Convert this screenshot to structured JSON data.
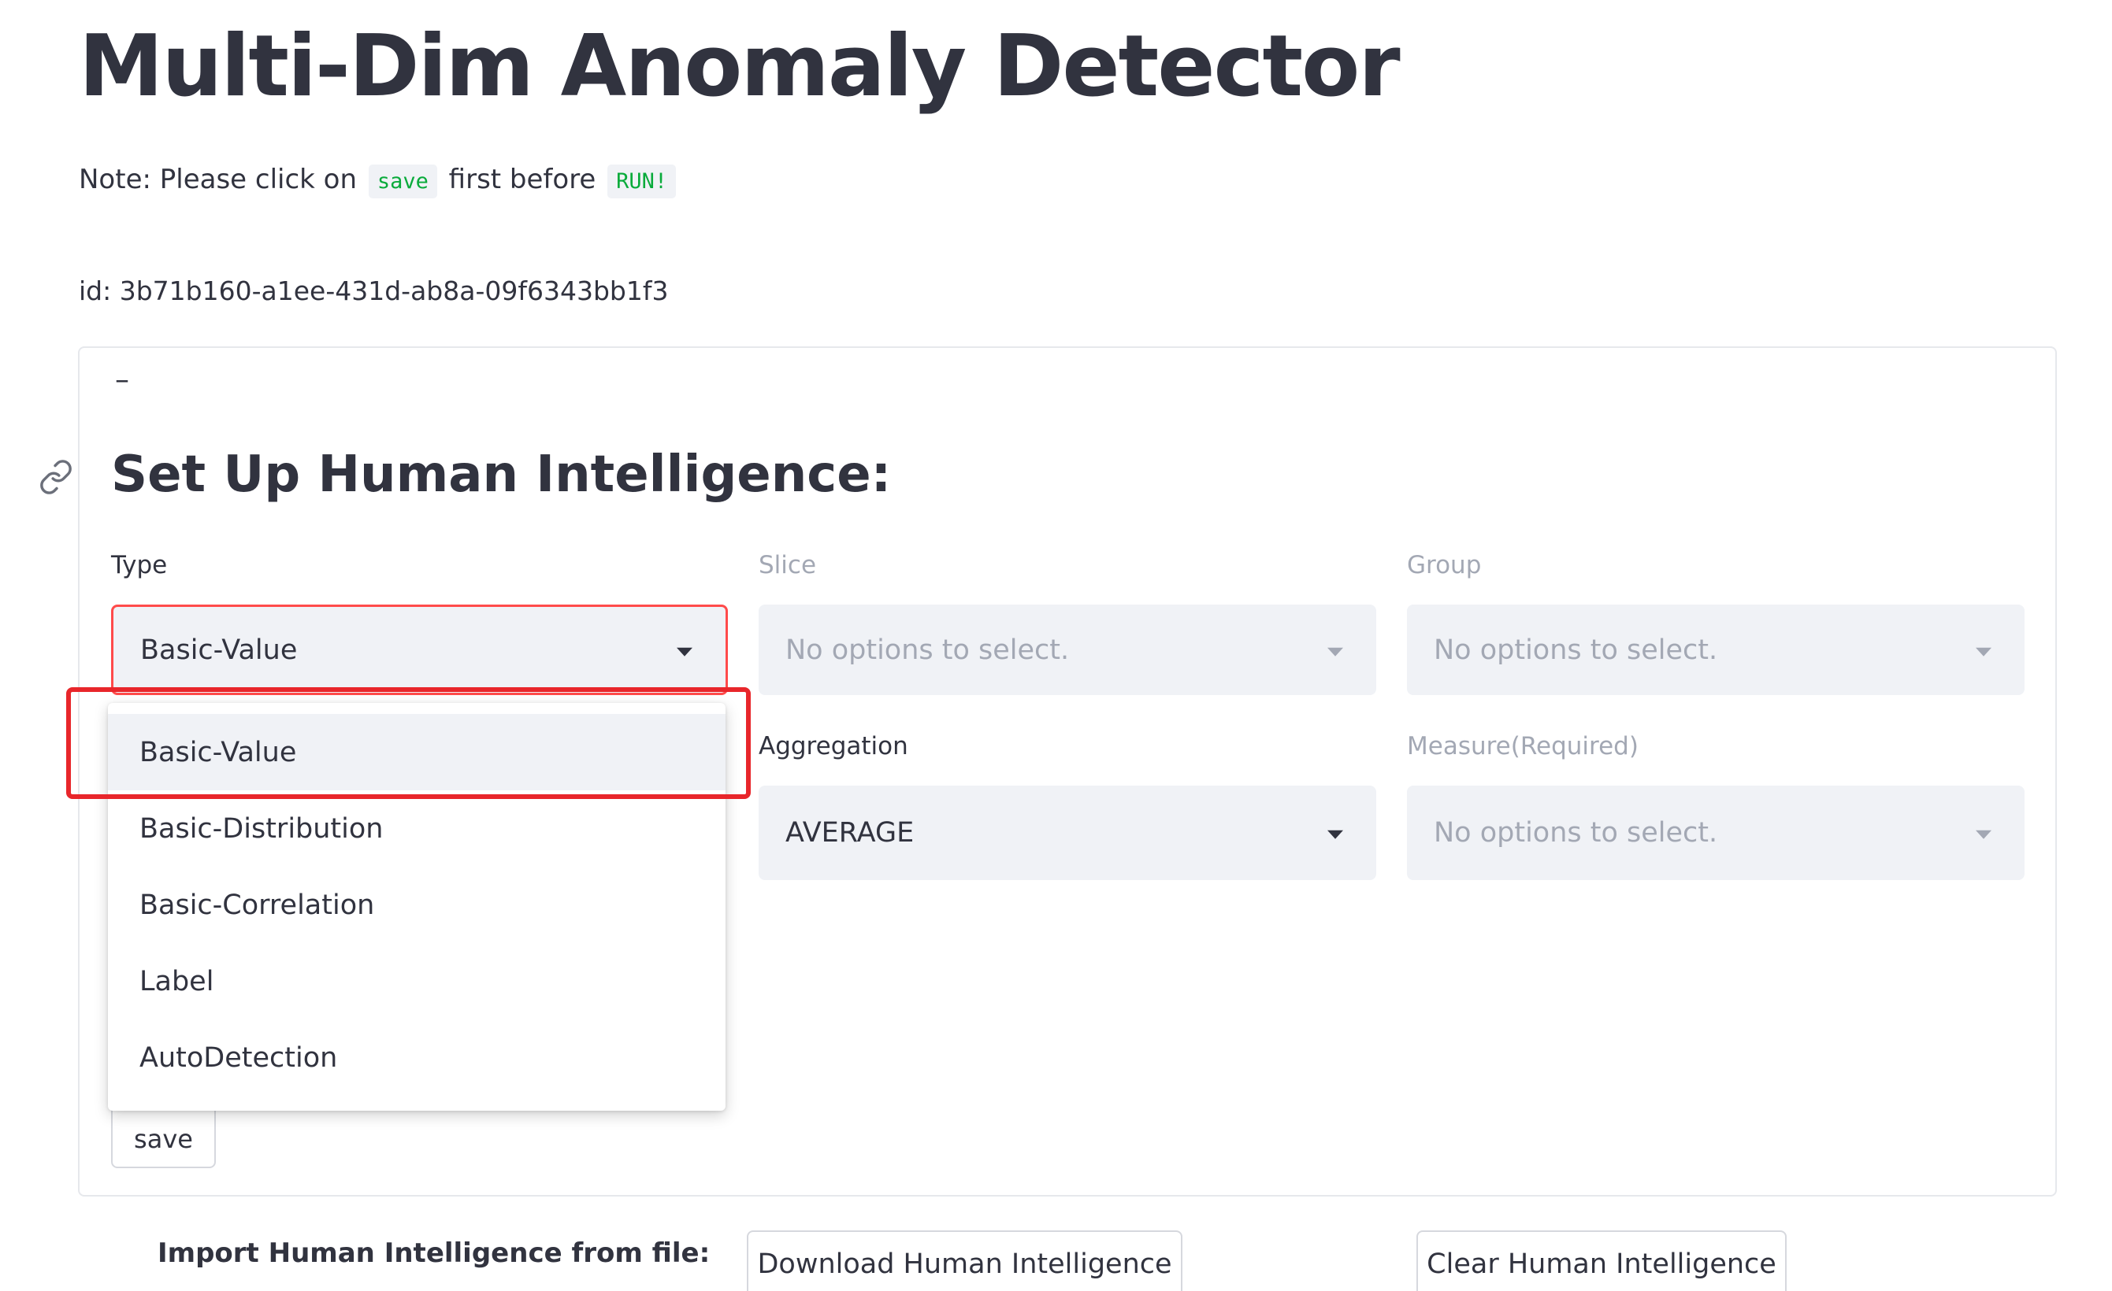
{
  "page": {
    "title": "Multi-Dim Anomaly Detector",
    "note": {
      "prefix": "Note: Please click on",
      "save_code": "save",
      "middle": "first before",
      "run_code": "RUN!"
    },
    "id_line": "id: 3b71b160-a1ee-431d-ab8a-09f6343bb1f3"
  },
  "expander": {
    "toggle_symbol": "–",
    "section_title": "Set Up Human Intelligence:",
    "fields": {
      "type": {
        "label": "Type",
        "value": "Basic-Value"
      },
      "slice": {
        "label": "Slice",
        "value": "No options to select."
      },
      "group": {
        "label": "Group",
        "value": "No options to select."
      },
      "aggregation": {
        "label": "Aggregation",
        "value": "AVERAGE"
      },
      "measure": {
        "label": "Measure(Required)",
        "value": "No options to select."
      }
    },
    "type_dropdown": {
      "options": [
        "Basic-Value",
        "Basic-Distribution",
        "Basic-Correlation",
        "Label",
        "AutoDetection"
      ],
      "highlighted_index": 0
    },
    "save_label": "save"
  },
  "footer": {
    "import_label": "Import Human Intelligence from file:",
    "download_label": "Download Human Intelligence",
    "clear_label": "Clear Human Intelligence"
  },
  "colors": {
    "focus_border": "#ff4b4b",
    "annotation_box": "#e8262b",
    "select_bg": "#f0f2f6",
    "code_text": "#09ab3b"
  }
}
